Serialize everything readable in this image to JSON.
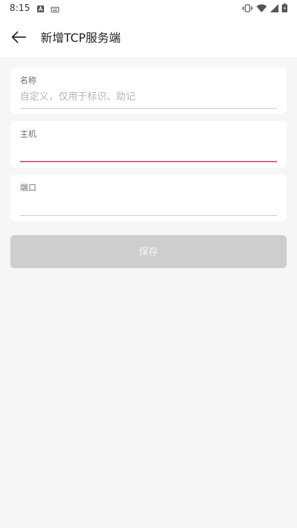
{
  "status_bar": {
    "time": "8:15",
    "left_icons": [
      "font-a-icon",
      "keyboard-icon"
    ],
    "right_icons": [
      "vibrate-icon",
      "wifi-icon",
      "signal-icon",
      "battery-icon"
    ]
  },
  "app_bar": {
    "back_icon": "arrow-left-icon",
    "title": "新增TCP服务端"
  },
  "form": {
    "name": {
      "label": "名称",
      "value": "",
      "placeholder": "自定义，仅用于标识、助记"
    },
    "host": {
      "label": "主机",
      "value": "",
      "placeholder": ""
    },
    "port": {
      "label": "端口",
      "value": "",
      "placeholder": ""
    }
  },
  "actions": {
    "save_label": "保存"
  },
  "colors": {
    "background": "#f6f6f6",
    "card": "#ffffff",
    "focused_underline": "#c9677a",
    "underline": "#c9c9c9",
    "save_button_disabled": "#cecece"
  }
}
